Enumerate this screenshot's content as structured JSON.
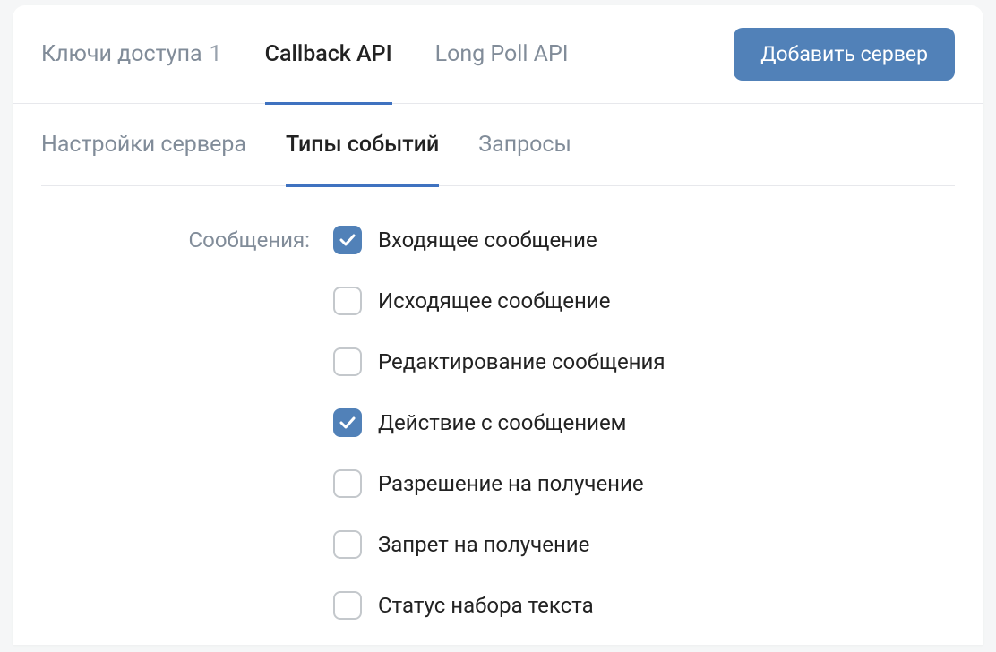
{
  "topTabs": [
    {
      "label": "Ключи доступа",
      "count": "1",
      "active": false
    },
    {
      "label": "Callback API",
      "count": "",
      "active": true
    },
    {
      "label": "Long Poll API",
      "count": "",
      "active": false
    }
  ],
  "addServerButton": "Добавить сервер",
  "subTabs": [
    {
      "label": "Настройки сервера",
      "active": false
    },
    {
      "label": "Типы событий",
      "active": true
    },
    {
      "label": "Запросы",
      "active": false
    }
  ],
  "section": {
    "label": "Сообщения:",
    "options": [
      {
        "label": "Входящее сообщение",
        "checked": true
      },
      {
        "label": "Исходящее сообщение",
        "checked": false
      },
      {
        "label": "Редактирование сообщения",
        "checked": false
      },
      {
        "label": "Действие с сообщением",
        "checked": true
      },
      {
        "label": "Разрешение на получение",
        "checked": false
      },
      {
        "label": "Запрет на получение",
        "checked": false
      },
      {
        "label": "Статус набора текста",
        "checked": false
      }
    ]
  }
}
